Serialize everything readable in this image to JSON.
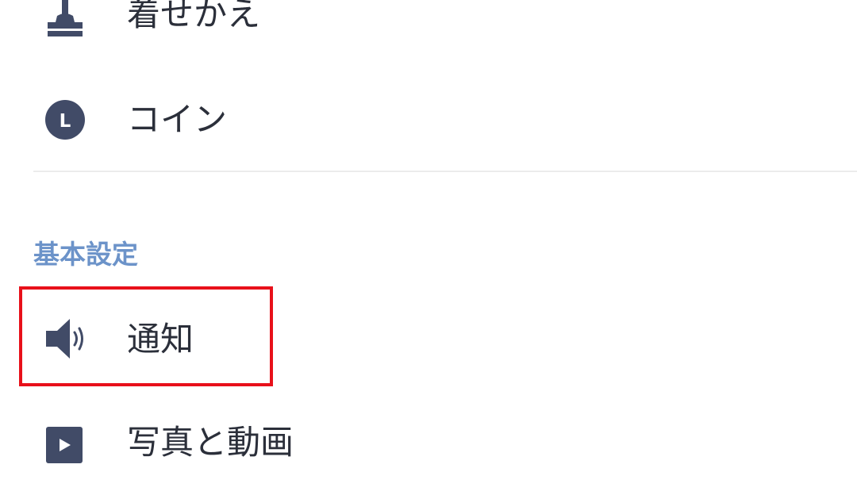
{
  "colors": {
    "icon": "#414b67",
    "text": "#2b2f3a",
    "section_header": "#6c93c9",
    "divider": "#ececec",
    "highlight": "#e8101a"
  },
  "menu": {
    "top_items": [
      {
        "label": "着せかえ",
        "icon": "paintbrush-icon"
      },
      {
        "label": "コイン",
        "icon": "coin-icon",
        "icon_text": "L"
      }
    ],
    "sections": [
      {
        "header": "基本設定",
        "items": [
          {
            "label": "通知",
            "icon": "speaker-icon",
            "highlighted": true
          },
          {
            "label": "写真と動画",
            "icon": "play-icon"
          }
        ]
      }
    ]
  }
}
